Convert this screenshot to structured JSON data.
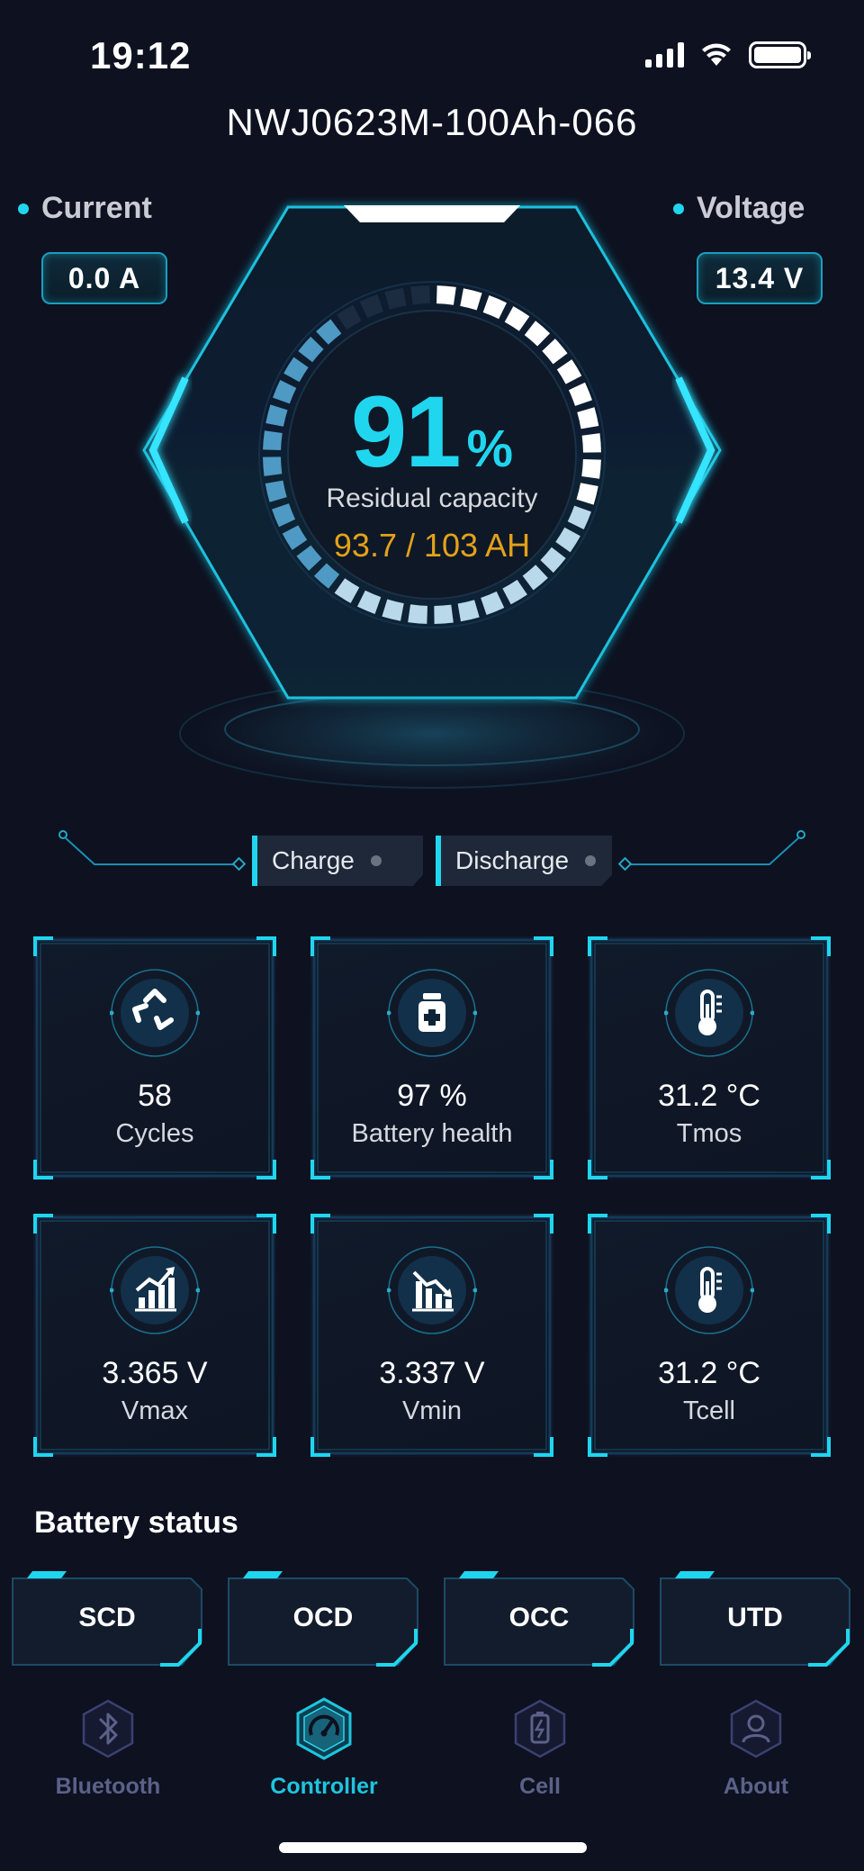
{
  "status_bar": {
    "time": "19:12"
  },
  "device_name": "NWJ0623M-100Ah-066",
  "current": {
    "label": "Current",
    "value": "0.0  A"
  },
  "voltage": {
    "label": "Voltage",
    "value": "13.4  V"
  },
  "gauge": {
    "percent": "91",
    "percent_sign": "%",
    "label": "Residual capacity",
    "capacity": "93.7 / 103 AH",
    "level": 0.91
  },
  "switches": {
    "charge": "Charge",
    "discharge": "Discharge"
  },
  "tiles": [
    {
      "value": "58",
      "label": "Cycles",
      "icon": "recycle-icon"
    },
    {
      "value": "97 %",
      "label": "Battery health",
      "icon": "medicine-bottle-icon"
    },
    {
      "value": "31.2 °C",
      "label": "Tmos",
      "icon": "thermometer-icon"
    },
    {
      "value": "3.365 V",
      "label": "Vmax",
      "icon": "chart-up-icon"
    },
    {
      "value": "3.337 V",
      "label": "Vmin",
      "icon": "chart-down-icon"
    },
    {
      "value": "31.2 °C",
      "label": "Tcell",
      "icon": "thermometer-icon"
    }
  ],
  "battery_status": {
    "title": "Battery status",
    "items": [
      "SCD",
      "OCD",
      "OCC",
      "UTD"
    ]
  },
  "nav": {
    "items": [
      {
        "label": "Bluetooth",
        "icon": "bluetooth-icon"
      },
      {
        "label": "Controller",
        "icon": "speedometer-icon"
      },
      {
        "label": "Cell",
        "icon": "battery-cell-icon"
      },
      {
        "label": "About",
        "icon": "user-icon"
      }
    ],
    "active": "Controller"
  },
  "colors": {
    "accent": "#20d6ef",
    "capacity": "#e3a21a",
    "background": "#0d1120",
    "nav_inactive": "#5b6189"
  }
}
